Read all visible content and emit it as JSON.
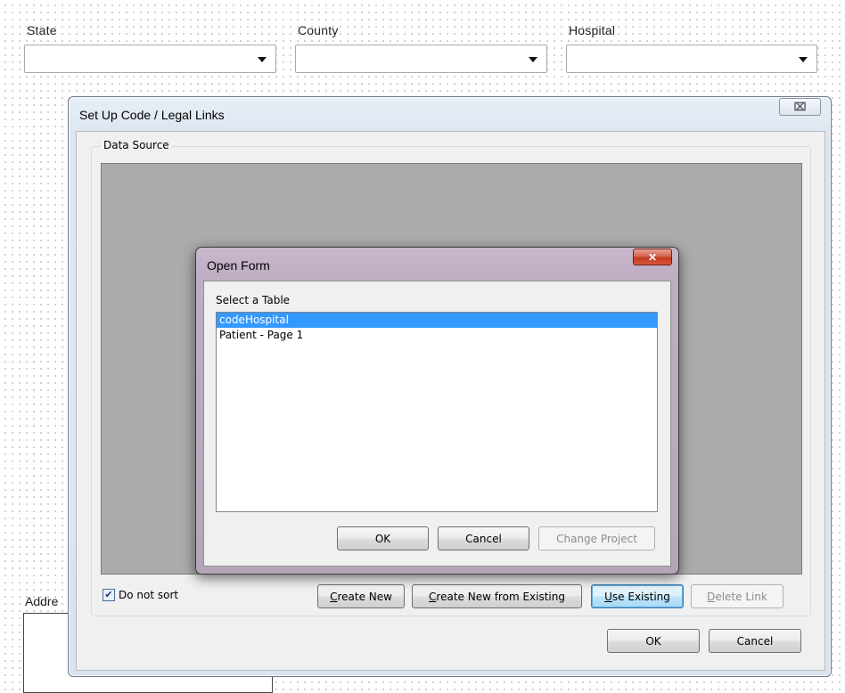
{
  "background_form": {
    "fields": [
      {
        "label": "State",
        "value": ""
      },
      {
        "label": "County",
        "value": ""
      },
      {
        "label": "Hospital",
        "value": ""
      }
    ],
    "address_label": "Addre"
  },
  "main_dialog": {
    "title": "Set Up Code / Legal Links",
    "close_symbol": "⌧",
    "group_label": "Data Source",
    "checkbox": {
      "label": "Do not sort",
      "checked": true
    },
    "buttons": {
      "create_new": {
        "mnemonic": "C",
        "rest": "reate New"
      },
      "create_from_existing": {
        "mnemonic": "C",
        "rest": "reate New from Existing"
      },
      "use_existing": {
        "mnemonic": "U",
        "rest": "se Existing"
      },
      "delete_link": {
        "mnemonic": "D",
        "rest": "elete Link"
      },
      "ok": "OK",
      "cancel": "Cancel"
    }
  },
  "open_form": {
    "title": "Open Form",
    "close_symbol": "✕",
    "list_label": "Select a Table",
    "items": [
      "codeHospital",
      "Patient - Page 1"
    ],
    "buttons": {
      "ok": "OK",
      "cancel": "Cancel",
      "change_project": "Change Project"
    }
  }
}
